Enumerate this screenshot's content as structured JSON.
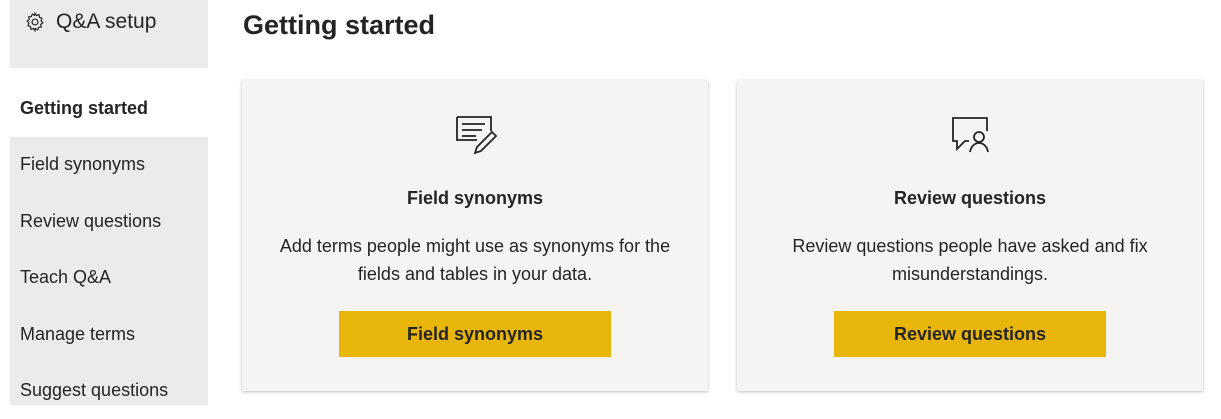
{
  "sidebar": {
    "title": "Q&A setup",
    "title_icon": "gear-icon",
    "items": [
      {
        "label": "Getting started",
        "active": true
      },
      {
        "label": "Field synonyms",
        "active": false
      },
      {
        "label": "Review questions",
        "active": false
      },
      {
        "label": "Teach Q&A",
        "active": false
      },
      {
        "label": "Manage terms",
        "active": false
      },
      {
        "label": "Suggest questions",
        "active": false
      }
    ]
  },
  "main": {
    "title": "Getting started",
    "cards": [
      {
        "icon": "document-edit-icon",
        "title": "Field synonyms",
        "description": "Add terms people might use as synonyms for the fields and tables in your data.",
        "button_label": "Field synonyms"
      },
      {
        "icon": "chat-person-icon",
        "title": "Review questions",
        "description": "Review questions people have asked and fix misunderstandings.",
        "button_label": "Review questions"
      }
    ]
  },
  "colors": {
    "accent_button": "#e8b60a",
    "sidebar_bg": "#ebebeb",
    "card_bg": "#f5f4f2"
  }
}
